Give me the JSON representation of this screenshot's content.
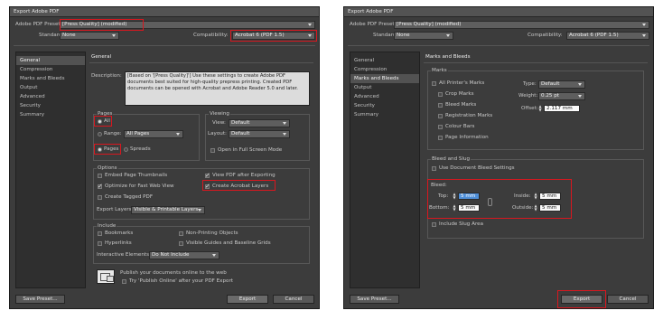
{
  "dialog1": {
    "title": "Export Adobe PDF",
    "preset_label": "Adobe PDF Preset:",
    "preset_value": "[Press Quality] (modified)",
    "standard_label": "Standard:",
    "standard_value": "None",
    "compat_label": "Compatibility:",
    "compat_value": "Acrobat 6 (PDF 1.5)",
    "sidebar": [
      "General",
      "Compression",
      "Marks and Bleeds",
      "Output",
      "Advanced",
      "Security",
      "Summary"
    ],
    "section_title": "General",
    "description_label": "Description:",
    "description_text": "[Based on '[Press Quality]'] Use these settings to create Adobe PDF documents best suited for high-quality prepress printing. Created PDF documents can be opened with Acrobat and Adobe Reader 5.0 and later.",
    "pages": {
      "title": "Pages",
      "all": "All",
      "range_label": "Range:",
      "range_value": "All Pages",
      "pages_opt": "Pages",
      "spreads_opt": "Spreads"
    },
    "viewing": {
      "title": "Viewing",
      "view_label": "View:",
      "view_value": "Default",
      "layout_label": "Layout:",
      "layout_value": "Default",
      "fullscreen": "Open in Full Screen Mode"
    },
    "options": {
      "title": "Options",
      "embed": "Embed Page Thumbnails",
      "view_after": "View PDF after Exporting",
      "optimize": "Optimize for Fast Web View",
      "create_layers": "Create Acrobat Layers",
      "tagged": "Create Tagged PDF",
      "export_layers_label": "Export Layers:",
      "export_layers_value": "Visible & Printable Layers"
    },
    "include": {
      "title": "Include",
      "bookmarks": "Bookmarks",
      "nonprinting": "Non-Printing Objects",
      "hyperlinks": "Hyperlinks",
      "guides": "Visible Guides and Baseline Grids",
      "interactive_label": "Interactive Elements:",
      "interactive_value": "Do Not Include"
    },
    "publish": {
      "line1": "Publish your documents online to the web",
      "line2": "Try 'Publish Online' after your PDF Export"
    },
    "buttons": {
      "save_preset": "Save Preset...",
      "export": "Export",
      "cancel": "Cancel"
    }
  },
  "dialog2": {
    "title": "Export Adobe PDF",
    "preset_label": "Adobe PDF Preset:",
    "preset_value": "[Press Quality] (modified)",
    "standard_label": "Standard:",
    "standard_value": "None",
    "compat_label": "Compatibility:",
    "compat_value": "Acrobat 6 (PDF 1.5)",
    "sidebar": [
      "General",
      "Compression",
      "Marks and Bleeds",
      "Output",
      "Advanced",
      "Security",
      "Summary"
    ],
    "section_title": "Marks and Bleeds",
    "marks": {
      "title": "Marks",
      "all_printers": "All Printer's Marks",
      "crop": "Crop Marks",
      "bleed": "Bleed Marks",
      "registration": "Registration Marks",
      "colour": "Colour Bars",
      "page_info": "Page Information",
      "type_label": "Type:",
      "type_value": "Default",
      "weight_label": "Weight:",
      "weight_value": "0.25 pt",
      "offset_label": "Offset:",
      "offset_value": "2.117 mm"
    },
    "bleed_slug": {
      "title": "Bleed and Slug",
      "use_doc": "Use Document Bleed Settings",
      "bleed_label": "Bleed:",
      "top_label": "Top:",
      "top_value": "5 mm",
      "bottom_label": "Bottom:",
      "bottom_value": "5 mm",
      "inside_label": "Inside:",
      "inside_value": "5 mm",
      "outside_label": "Outside:",
      "outside_value": "5 mm",
      "include_slug": "Include Slug Area"
    },
    "buttons": {
      "save_preset": "Save Preset...",
      "export": "Export",
      "cancel": "Cancel"
    }
  }
}
